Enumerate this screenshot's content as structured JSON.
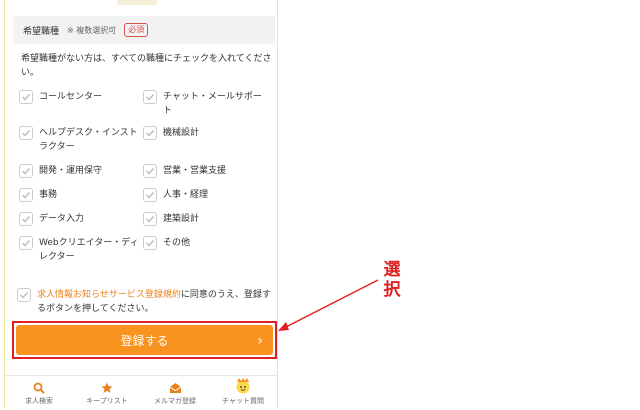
{
  "form": {
    "field_title": "希望職種",
    "field_note": "※ 複数選択可",
    "required_badge": "必須",
    "instruction": "希望職種がない方は、すべての職種にチェックを入れてください。",
    "options": [
      {
        "label": "コールセンター",
        "checked": true
      },
      {
        "label": "チャット・メールサポート",
        "checked": true
      },
      {
        "label": "ヘルプデスク・インストラクター",
        "checked": true
      },
      {
        "label": "機械設計",
        "checked": true
      },
      {
        "label": "開発・運用保守",
        "checked": true
      },
      {
        "label": "営業・営業支援",
        "checked": true
      },
      {
        "label": "事務",
        "checked": true
      },
      {
        "label": "人事・経理",
        "checked": true
      },
      {
        "label": "データ入力",
        "checked": true
      },
      {
        "label": "建築設計",
        "checked": true
      },
      {
        "label": "Webクリエイター・ディレクター",
        "checked": true
      },
      {
        "label": "その他",
        "checked": true
      }
    ],
    "consent_link": "求人情報お知らせサービス登録規約",
    "consent_text": "に同意のうえ、登録するボタンを押してください。",
    "submit_label": "登録する",
    "submit_chevron": "›"
  },
  "bottom_nav": [
    {
      "label": "求人検索",
      "icon": "search-icon"
    },
    {
      "label": "キープリスト",
      "icon": "star-icon"
    },
    {
      "label": "メルマガ登録",
      "icon": "mail-icon"
    },
    {
      "label": "チャット質問",
      "icon": "chat-character-icon"
    }
  ],
  "annotation": {
    "text_line1": "選",
    "text_line2": "択"
  },
  "colors": {
    "accent": "#f7931e",
    "highlight": "#e02020",
    "link": "#e8821e"
  }
}
